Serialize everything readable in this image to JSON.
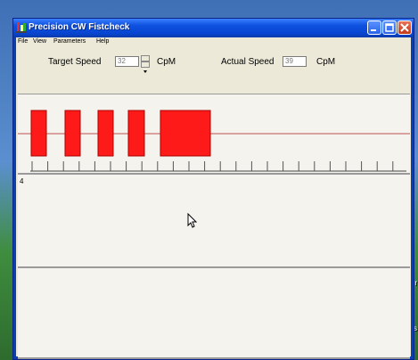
{
  "window": {
    "title": "Precision CW Fistcheck"
  },
  "menu": {
    "items": [
      "File",
      "View",
      "Parameters",
      "Help"
    ]
  },
  "controls": {
    "target_speed_label": "Target Speed",
    "target_speed_value": "32",
    "target_speed_unit": "CpM",
    "actual_speed_label": "Actual Speed",
    "actual_speed_value": "39",
    "actual_speed_unit": "CpM"
  },
  "output": {
    "text": "4"
  },
  "desktop": {
    "side_label": "ies"
  },
  "colors": {
    "element_fill": "#ff1a1a",
    "baseline": "#c0504d"
  },
  "icons": {
    "minimize": "minimize-icon",
    "maximize": "maximize-icon",
    "close": "close-icon",
    "app": "app-icon",
    "cursor": "mouse-cursor-icon"
  }
}
